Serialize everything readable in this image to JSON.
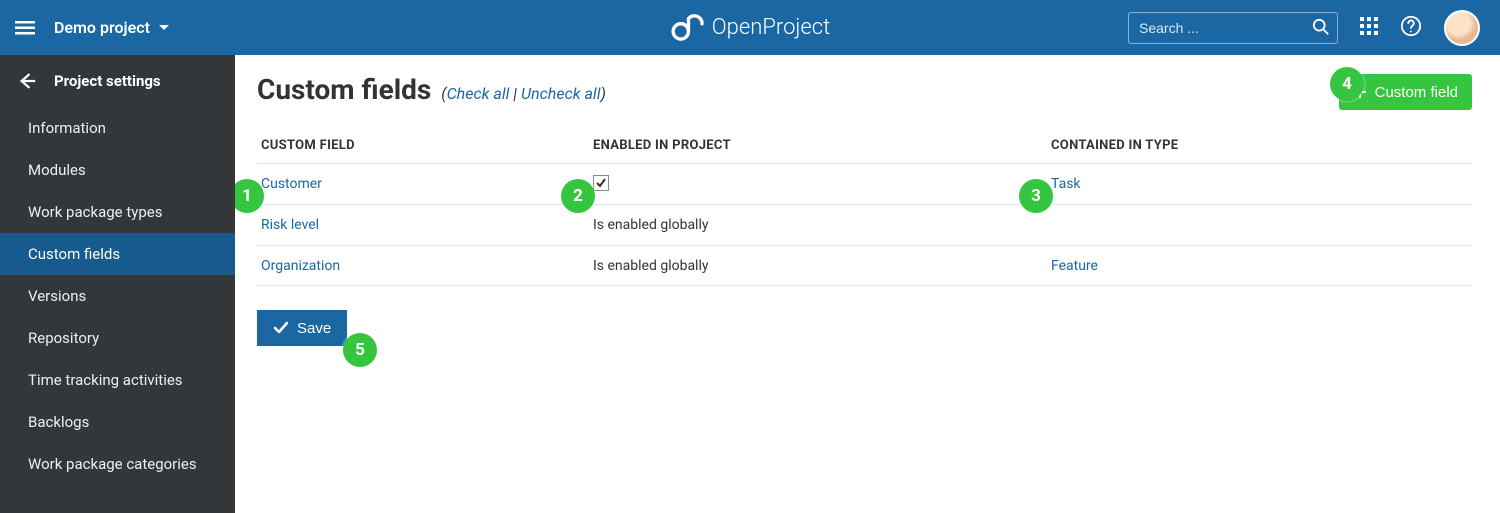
{
  "topbar": {
    "project_name": "Demo project",
    "logo_text": "OpenProject",
    "search_placeholder": "Search ..."
  },
  "sidebar": {
    "heading": "Project settings",
    "items": [
      {
        "label": "Information"
      },
      {
        "label": "Modules"
      },
      {
        "label": "Work package types"
      },
      {
        "label": "Custom fields"
      },
      {
        "label": "Versions"
      },
      {
        "label": "Repository"
      },
      {
        "label": "Time tracking activities"
      },
      {
        "label": "Backlogs"
      },
      {
        "label": "Work package categories"
      }
    ],
    "active_index": 3
  },
  "page": {
    "title": "Custom fields",
    "check_all": "Check all",
    "uncheck_all": "Uncheck all",
    "new_button": "Custom field",
    "save_button": "Save",
    "columns": {
      "name": "CUSTOM FIELD",
      "enabled": "ENABLED IN PROJECT",
      "type": "CONTAINED IN TYPE"
    },
    "rows": [
      {
        "name": "Customer",
        "enabled": "checkbox",
        "checked": true,
        "type": "Task"
      },
      {
        "name": "Risk level",
        "enabled": "Is enabled globally",
        "type": ""
      },
      {
        "name": "Organization",
        "enabled": "Is enabled globally",
        "type": "Feature"
      }
    ]
  },
  "annotations": [
    "1",
    "2",
    "3",
    "4",
    "5"
  ]
}
